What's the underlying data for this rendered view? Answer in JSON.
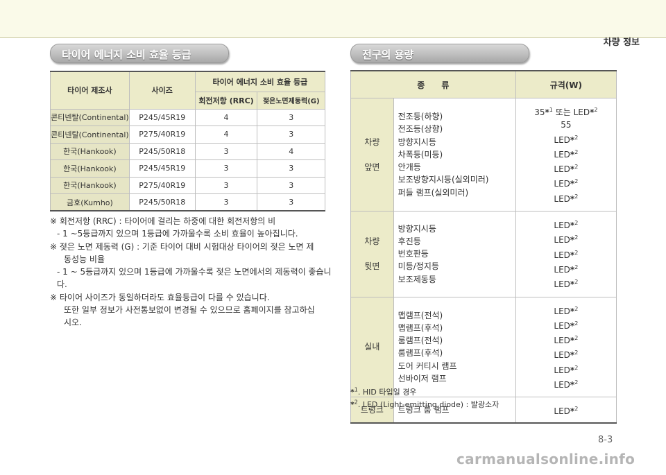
{
  "header": {
    "section": "차량 정보"
  },
  "left": {
    "title": "타이어 에너지 소비 효율 등급",
    "table": {
      "h_maker": "타이어 제조사",
      "h_size": "사이즈",
      "h_grade": "타이어 에너지 소비 효율 등급",
      "h_rrc": "회전저항 (RRC)",
      "h_g": "젖은노면제동력(G)",
      "rows": [
        {
          "maker": "콘티넨탈(Continental)",
          "size": "P245/45R19",
          "rrc": "4",
          "g": "3"
        },
        {
          "maker": "콘티넨탈(Continental)",
          "size": "P275/40R19",
          "rrc": "4",
          "g": "3"
        },
        {
          "maker": "한국(Hankook)",
          "size": "P245/50R18",
          "rrc": "3",
          "g": "4"
        },
        {
          "maker": "한국(Hankook)",
          "size": "P245/45R19",
          "rrc": "3",
          "g": "3"
        },
        {
          "maker": "한국(Hankook)",
          "size": "P275/40R19",
          "rrc": "3",
          "g": "3"
        },
        {
          "maker": "금호(Kumho)",
          "size": "P245/50R18",
          "rrc": "3",
          "g": "3"
        }
      ]
    },
    "notes": [
      "※ 회전저항 (RRC) : 타이어에 걸리는 하중에 대한 회전저항의 비",
      "- 1 ~5등급까지 있으며 1등급에 가까울수록 소비 효율이 높아집니다.",
      "※ 젖은 노면 제동력 (G) : 기준 타이어 대비 시험대상 타이어의 젖은 노면 제",
      "동성능 비율",
      "- 1 ~ 5등급까지 있으며 1등급에 가까울수록 젖은 노면에서의 제동력이 좋습니다.",
      "※ 타이어 사이즈가 동일하더라도 효율등급이 다를 수 있습니다.",
      "또한 일부 정보가 사전통보없이 변경될 수 있으므로 홈페이지를 참고하십",
      "시오."
    ]
  },
  "right": {
    "title": "전구의 용량",
    "h_type": "종　　류",
    "h_spec": "규격(W)",
    "groups": [
      {
        "cat": [
          "차량",
          "앞면"
        ],
        "items": [
          "전조등(하향)",
          "전조등(상향)",
          "방향지시등",
          "차폭등(미등)",
          "안개등",
          "보조방향지시등(실외미러)",
          "퍼들 램프(실외미러)"
        ],
        "specs": [
          "35*1 또는 LED*2",
          "55",
          "LED*2",
          "LED*2",
          "LED*2",
          "LED*2",
          "LED*2"
        ]
      },
      {
        "cat": [
          "차량",
          "뒷면"
        ],
        "items": [
          "방향지시등",
          "후진등",
          "번호판등",
          "미등/정지등",
          "보조제동등"
        ],
        "specs": [
          "LED*2",
          "LED*2",
          "LED*2",
          "LED*2",
          "LED*2"
        ]
      },
      {
        "cat": [
          "실내"
        ],
        "items": [
          "맵램프(전석)",
          "맵램프(후석)",
          "룸램프(전석)",
          "룸램프(후석)",
          "도어 커티시 램프",
          "선바이저 램프"
        ],
        "specs": [
          "LED*2",
          "LED*2",
          "LED*2",
          "LED*2",
          "LED*2",
          "LED*2"
        ]
      },
      {
        "cat": [
          "트렁크"
        ],
        "items": [
          "트렁크 룸 램프"
        ],
        "specs": [
          "LED*2"
        ]
      }
    ],
    "footnotes": [
      "*1. HID 타입일 경우",
      "*2. LED (Light-emitting diode) : 발광소자"
    ]
  },
  "page_number": "8-3",
  "watermark": "carmanualsonline.info"
}
